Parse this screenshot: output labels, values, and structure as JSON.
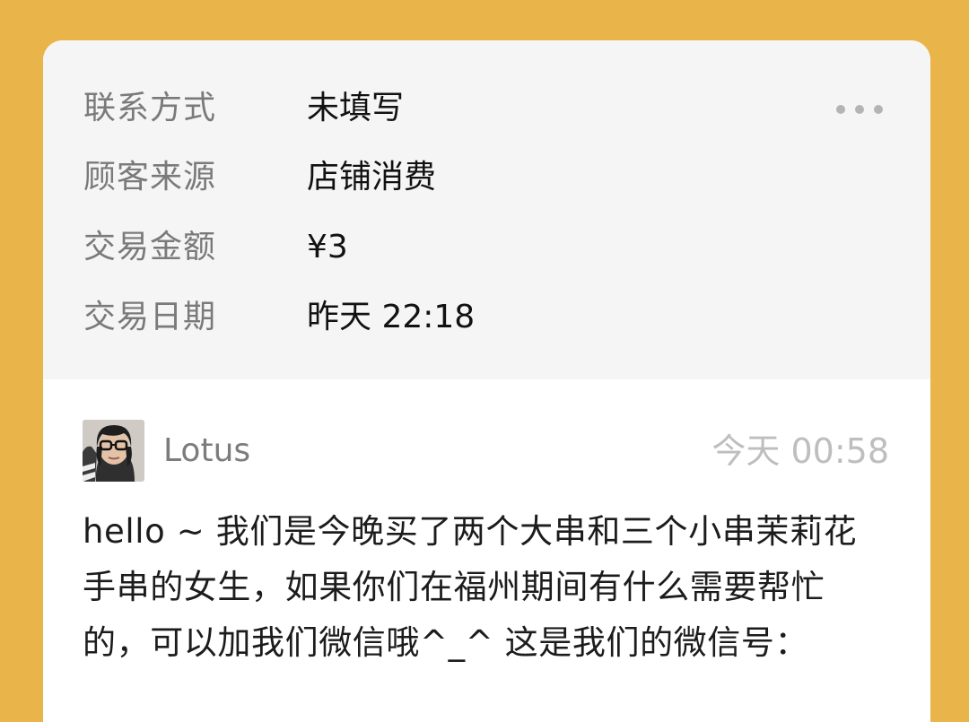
{
  "info": {
    "rows": [
      {
        "label": "联系方式",
        "value": "未填写"
      },
      {
        "label": "顾客来源",
        "value": "店铺消费"
      },
      {
        "label": "交易金额",
        "value": "¥3"
      },
      {
        "label": "交易日期",
        "value": "昨天 22:18"
      }
    ],
    "more_icon": "more-horizontal-icon"
  },
  "message": {
    "username": "Lotus",
    "timestamp": "今天 00:58",
    "avatar_icon": "user-photo-avatar",
    "lines": [
      "hello ~ 我们是今晚买了两个大串和三个小串茉莉花",
      "手串的女生，如果你们在福州期间有什么需要帮忙",
      "的，可以加我们微信哦^_^ 这是我们的微信号："
    ]
  },
  "colors": {
    "background": "#E9B54A",
    "panel": "#F5F5F5",
    "card": "#FFFFFF",
    "label_text": "#7A7A7A",
    "value_text": "#111111",
    "muted_text": "#BEBEBE"
  }
}
